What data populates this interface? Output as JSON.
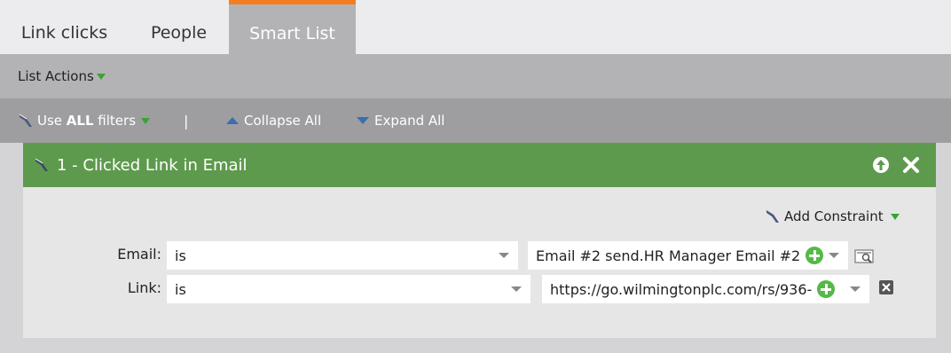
{
  "tabs": [
    {
      "label": "Link clicks",
      "active": false
    },
    {
      "label": "People",
      "active": false
    },
    {
      "label": "Smart List",
      "active": true
    }
  ],
  "list_actions": {
    "label": "List Actions"
  },
  "filter_toolbar": {
    "use_filters_prefix": "Use ",
    "use_filters_bold": "ALL",
    "use_filters_suffix": " filters",
    "separator": "|",
    "collapse_all": "Collapse All",
    "expand_all": "Expand All"
  },
  "filter": {
    "title": "1 - Clicked Link in Email",
    "add_constraint": "Add Constraint",
    "rows": [
      {
        "label": "Email:",
        "operator": "is",
        "value": "Email #2 send.HR Manager Email #2"
      },
      {
        "label": "Link:",
        "operator": "is",
        "value": "https://go.wilmingtonplc.com/rs/936-"
      }
    ]
  },
  "colors": {
    "accent_orange": "#f47d20",
    "filter_header_green": "#5e9a4d",
    "plus_green": "#55b947",
    "toolbar_gray": "#9e9ea1"
  }
}
